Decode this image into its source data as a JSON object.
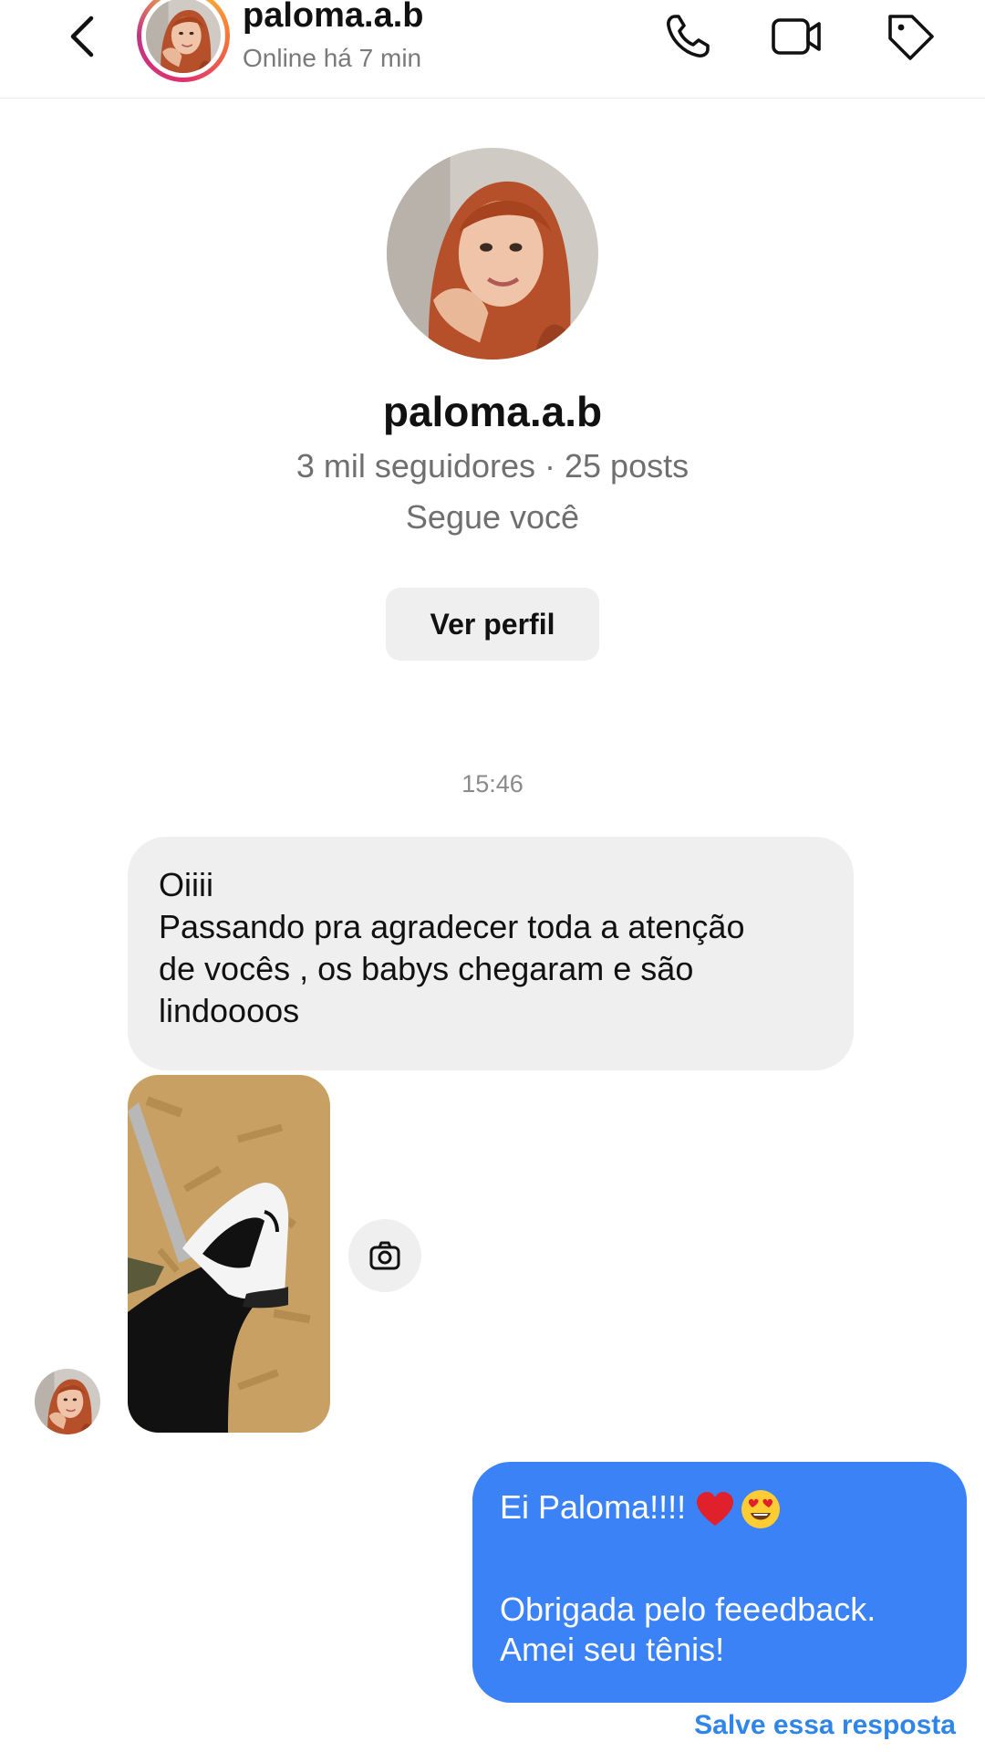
{
  "header": {
    "username": "paloma.a.b",
    "status": "Online há 7 min",
    "back_icon": "chevron-left-icon",
    "actions": [
      "phone-icon",
      "video-camera-icon",
      "tag-icon"
    ]
  },
  "profile": {
    "username": "paloma.a.b",
    "meta": "3 mil seguidores · 25 posts",
    "follow_status": "Segue você",
    "view_profile_label": "Ver perfil"
  },
  "messages": {
    "timestamp": "15:46",
    "incoming": {
      "lines": [
        "Oiiii",
        "Passando pra agradecer toda a atenção",
        "de vocês , os babys chegaram e são",
        "lindoooos"
      ]
    },
    "photo_icon": "camera-icon",
    "outgoing": {
      "line1": "Ei Paloma!!!!",
      "line1_emojis": [
        "red-heart-emoji",
        "heart-eyes-emoji"
      ],
      "line2": "Obrigada pelo feeedback.",
      "line3": "Amei seu tênis!"
    },
    "save_reply_label": "Salve essa resposta"
  },
  "colors": {
    "outgoing_bubble": "#3b82f6",
    "incoming_bubble": "#efefef",
    "link": "#2f86e8",
    "muted_text": "#6f6f6f"
  }
}
